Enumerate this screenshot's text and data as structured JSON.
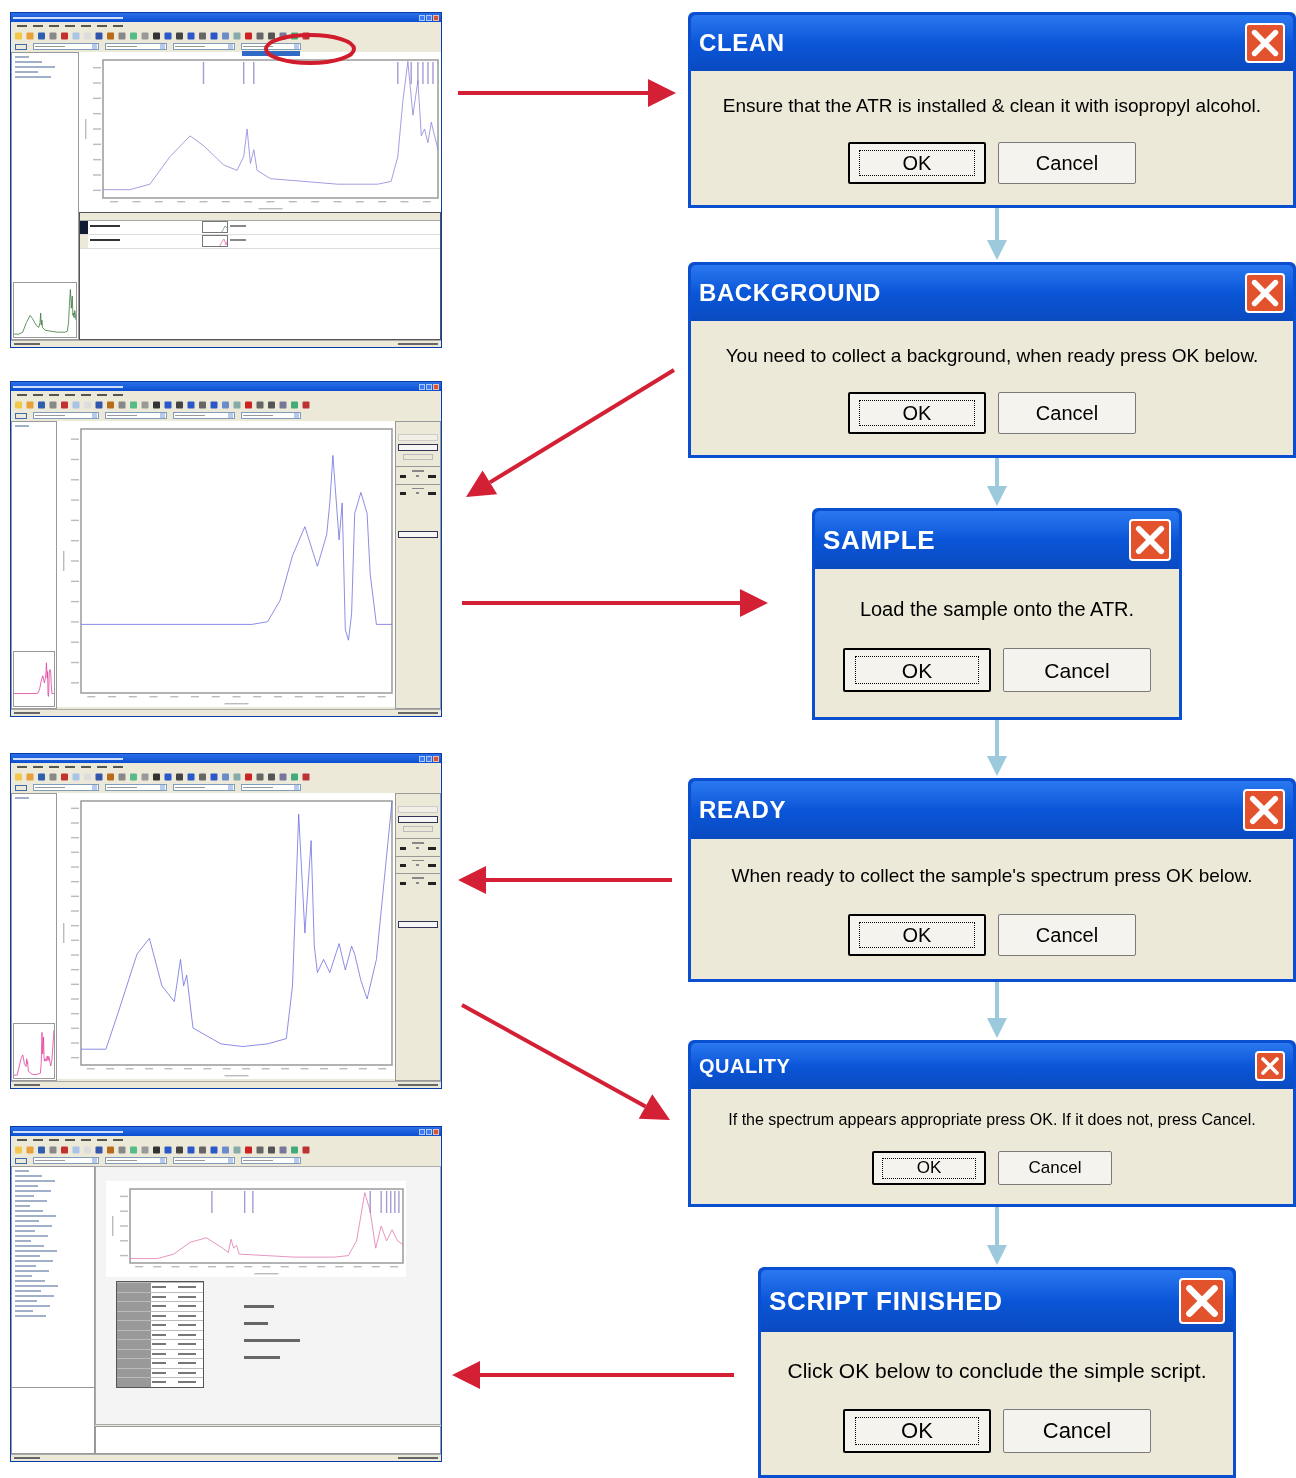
{
  "screenshots": [
    {
      "kind": "document",
      "highlight": true
    },
    {
      "kind": "collect",
      "highlight": false
    },
    {
      "kind": "collect",
      "highlight": false
    },
    {
      "kind": "report",
      "highlight": false
    }
  ],
  "dialogs": [
    {
      "title": "CLEAN",
      "message": "Ensure that the ATR is installed & clean it with isopropyl alcohol.",
      "buttons": [
        {
          "label": "OK",
          "focused": true
        },
        {
          "label": "Cancel",
          "focused": false
        }
      ]
    },
    {
      "title": "BACKGROUND",
      "message": "You need to collect a background, when ready press OK below.",
      "buttons": [
        {
          "label": "OK",
          "focused": true
        },
        {
          "label": "Cancel",
          "focused": false
        }
      ]
    },
    {
      "title": "SAMPLE",
      "message": "Load the sample onto the ATR.",
      "buttons": [
        {
          "label": "OK",
          "focused": true
        },
        {
          "label": "Cancel",
          "focused": false
        }
      ]
    },
    {
      "title": "READY",
      "message": "When ready to collect the sample's spectrum press OK below.",
      "buttons": [
        {
          "label": "OK",
          "focused": true
        },
        {
          "label": "Cancel",
          "focused": false
        }
      ]
    },
    {
      "title": "QUALITY",
      "message": "If the spectrum appears appropriate press OK. If it does not, press Cancel.",
      "buttons": [
        {
          "label": "OK",
          "focused": true
        },
        {
          "label": "Cancel",
          "focused": false
        }
      ]
    },
    {
      "title": "SCRIPT FINISHED",
      "message": "Click OK below to conclude the simple script.",
      "buttons": [
        {
          "label": "OK",
          "focused": true
        },
        {
          "label": "Cancel",
          "focused": false
        }
      ]
    }
  ]
}
